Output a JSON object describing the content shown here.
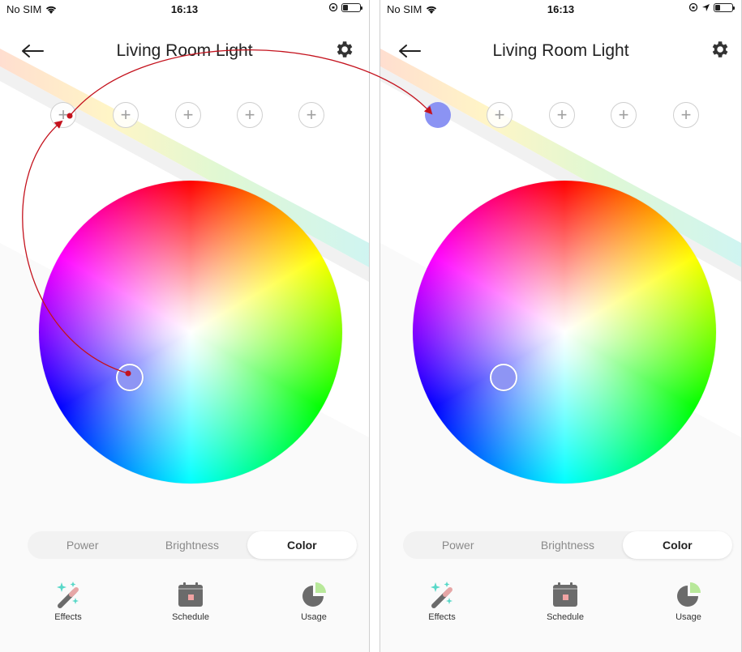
{
  "status": {
    "carrier": "No SIM",
    "time": "16:13"
  },
  "header": {
    "title": "Living Room Light"
  },
  "slots": [
    {
      "label": "+"
    },
    {
      "label": "+"
    },
    {
      "label": "+"
    },
    {
      "label": "+"
    },
    {
      "label": "+"
    }
  ],
  "tabs": {
    "power": "Power",
    "brightness": "Brightness",
    "color": "Color",
    "active": "Color"
  },
  "nav": {
    "effects": "Effects",
    "schedule": "Schedule",
    "usage": "Usage"
  },
  "colors": {
    "selected": "#8b93f3",
    "arrow": "#c4121d",
    "usage_slice": "#b8e89a",
    "icon_gray": "#6b6b6b",
    "effects_sparkle": "#58d8c8"
  }
}
